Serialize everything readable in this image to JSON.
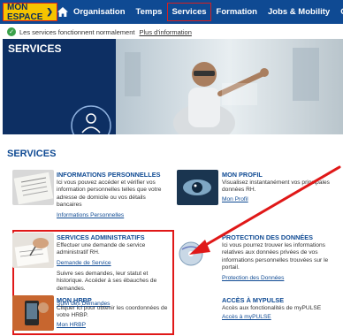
{
  "nav": {
    "espace_label": "MON ESPACE",
    "items": [
      {
        "label": "Organisation"
      },
      {
        "label": "Temps"
      },
      {
        "label": "Services"
      },
      {
        "label": "Formation"
      },
      {
        "label": "Jobs & Mobility"
      },
      {
        "label": "C"
      }
    ]
  },
  "status": {
    "text": "Les services fonctionnent normalement",
    "link": "Plus d'information"
  },
  "banner": {
    "title": "SERVICES"
  },
  "section_title": "SERVICES",
  "cards": {
    "info_perso": {
      "title": "INFORMATIONS PERSONNELLES",
      "desc": "Ici vous pouvez accéder et vérifier vos information personnelles telles que votre adresse de domicile ou vos détails bancaires",
      "link": "Informations Personnelles"
    },
    "profil": {
      "title": "MON PROFIL",
      "desc": "Visualisez instantanément vos principales données RH.",
      "link": "Mon Profil"
    },
    "admin": {
      "title": "SERVICES ADMINISTRATIFS",
      "desc1": "Effectuer une demande de service administratif RH.",
      "link1": "Demande de Service",
      "desc2": "Suivre ses demandes, leur statut et historique. Accéder à ses ébauches de demandes.",
      "link2": "Suivi des Demandes"
    },
    "protection": {
      "title": "PROTECTION DES DONNÉES",
      "desc": "Ici vous pourrez trouver les informations relatives aux données privées de vos informations personnelles trouvées sur le portail.",
      "link": "Protection des Données"
    },
    "hrbp": {
      "title": "MON HRBP",
      "desc": "Cliquer ici pour obtenir les coordonnées de votre HRBP.",
      "link": "Mon HRBP"
    },
    "mypulse": {
      "title": "ACCÈS À MYPULSE",
      "desc": "Accès aux fonctionalités de myPULSE",
      "link": "Accès à myPULSE"
    }
  },
  "colors": {
    "nav_bg": "#0f4a93",
    "espace_bg": "#f5c400",
    "highlight": "#e01818",
    "accent": "#0f4a93"
  }
}
